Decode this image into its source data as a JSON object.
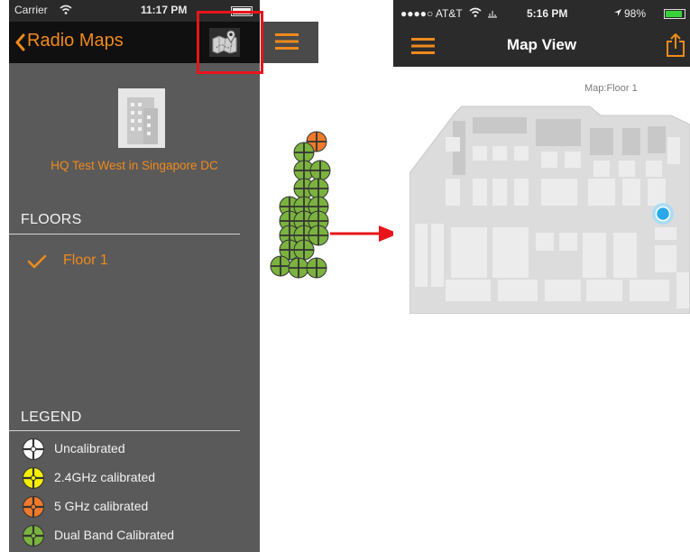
{
  "left_phone": {
    "status_bar": {
      "carrier": "Carrier",
      "time": "11:17 PM"
    },
    "nav": {
      "back_label": "Radio Maps",
      "map_icon": "folded-map-pin-icon",
      "menu_icon": "hamburger-menu-icon"
    },
    "building_name": "HQ Test West in Singapore DC",
    "floors": {
      "header": "FLOORS",
      "items": [
        {
          "label": "Floor 1",
          "selected": true
        }
      ]
    },
    "legend": {
      "header": "LEGEND",
      "items": [
        {
          "label": "Uncalibrated",
          "color": "#ffffff"
        },
        {
          "label": "2.4GHz calibrated",
          "color": "#f5f000"
        },
        {
          "label": "5 GHz calibrated",
          "color": "#f07a2a"
        },
        {
          "label": "Dual Band Calibrated",
          "color": "#7bb33e"
        }
      ]
    }
  },
  "right_phone": {
    "status_bar": {
      "carrier": "●●●●○ AT&T",
      "time": "5:16 PM",
      "battery": "98%"
    },
    "nav": {
      "title": "Map View",
      "menu_icon": "hamburger-menu-icon",
      "share_icon": "share-icon"
    },
    "map_caption": "Map:Floor 1"
  },
  "colors": {
    "accent": "#f08a1c",
    "highlight": "#e8141a",
    "arrow": "#e8141a",
    "location_dot": "#29a9e8",
    "panel_bg": "#5a5a5a"
  }
}
